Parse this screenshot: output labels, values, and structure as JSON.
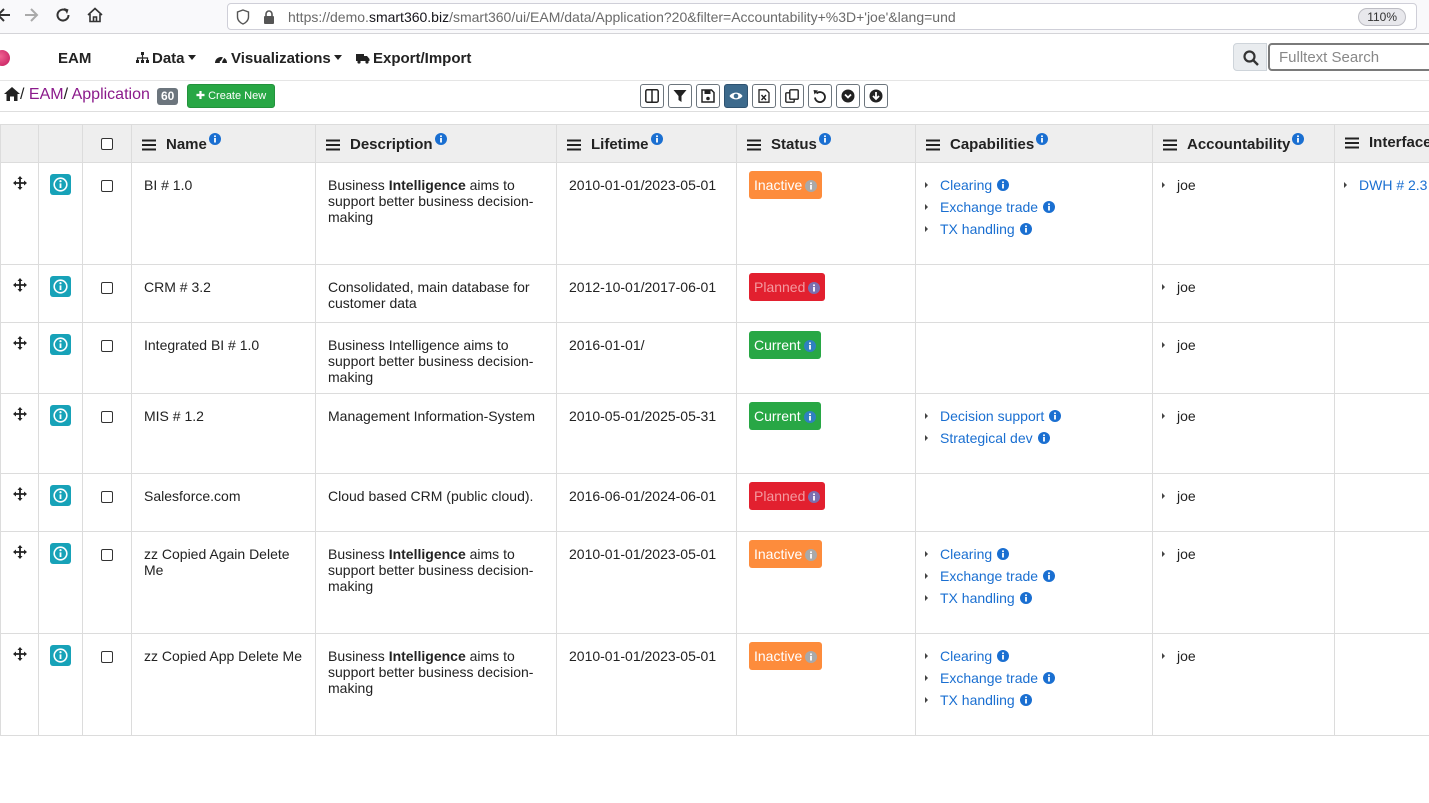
{
  "browser": {
    "url_prefix": "https://demo.",
    "url_host": "smart360.biz",
    "url_path": "/smart360/ui/EAM/data/Application?20&filter=Accountability+%3D+'joe'&lang=und",
    "zoom": "110%"
  },
  "navbar": {
    "brand": "EAM",
    "menu_data": "Data",
    "menu_visualizations": "Visualizations",
    "menu_export": "Export/Import",
    "search_placeholder": "Fulltext Search"
  },
  "breadcrumb": {
    "sep1": "/",
    "eam": "EAM",
    "sep2": "/",
    "application": "Application",
    "count": "60",
    "create_label": "Create New"
  },
  "columns": {
    "name": "Name",
    "description": "Description",
    "lifetime": "Lifetime",
    "status": "Status",
    "capabilities": "Capabilities",
    "accountability": "Accountability",
    "interfaces": "Interfaces"
  },
  "rows": [
    {
      "name": "BI # 1.0",
      "desc_pre": "Business ",
      "desc_bold": "Intelligence",
      "desc_post": " aims to support better business decision-making",
      "lifetime": "2010-01-01/2023-05-01",
      "status": "Inactive",
      "capabilities": [
        "Clearing",
        "Exchange trade",
        "TX handling"
      ],
      "accountability": "joe",
      "interface": "DWH # 2.3"
    },
    {
      "name": "CRM # 3.2",
      "desc_pre": "Consolidated, main database for customer data",
      "desc_bold": "",
      "desc_post": "",
      "lifetime": "2012-10-01/2017-06-01",
      "status": "Planned",
      "capabilities": [],
      "accountability": "joe",
      "interface": ""
    },
    {
      "name": "Integrated BI # 1.0",
      "desc_pre": "Business Intelligence aims to support better business decision-making",
      "desc_bold": "",
      "desc_post": "",
      "lifetime": "2016-01-01/",
      "status": "Current",
      "capabilities": [],
      "accountability": "joe",
      "interface": ""
    },
    {
      "name": "MIS # 1.2",
      "desc_pre": "Management Information-System",
      "desc_bold": "",
      "desc_post": "",
      "lifetime": "2010-05-01/2025-05-31",
      "status": "Current",
      "capabilities": [
        "Decision support",
        "Strategical dev"
      ],
      "accountability": "joe",
      "interface": ""
    },
    {
      "name": "Salesforce.com",
      "desc_pre": "Cloud based CRM (public cloud).",
      "desc_bold": "",
      "desc_post": "",
      "lifetime": "2016-06-01/2024-06-01",
      "status": "Planned",
      "capabilities": [],
      "accountability": "joe",
      "interface": ""
    },
    {
      "name": "zz Copied Again Delete Me",
      "desc_pre": "Business ",
      "desc_bold": "Intelligence",
      "desc_post": " aims to support better business decision-making",
      "lifetime": "2010-01-01/2023-05-01",
      "status": "Inactive",
      "capabilities": [
        "Clearing",
        "Exchange trade",
        "TX handling"
      ],
      "accountability": "joe",
      "interface": ""
    },
    {
      "name": "zz Copied App Delete Me",
      "desc_pre": "Business ",
      "desc_bold": "Intelligence",
      "desc_post": " aims to support better business decision-making",
      "lifetime": "2010-01-01/2023-05-01",
      "status": "Inactive",
      "capabilities": [
        "Clearing",
        "Exchange trade",
        "TX handling"
      ],
      "accountability": "joe",
      "interface": ""
    }
  ],
  "colors": {
    "link": "#1a6fd1",
    "breadcrumb_link": "#8b1a8b",
    "status_inactive": "#fd8c3c",
    "status_planned": "#e2202f",
    "status_current": "#28a745",
    "info_button": "#17a2b8",
    "create_button": "#28a745"
  },
  "icons": {
    "toolbar": [
      "columns-icon",
      "filter-icon",
      "save-icon",
      "eye-icon",
      "excel-export-icon",
      "copy-icon",
      "undo-icon",
      "chevron-down-circle-icon",
      "arrow-down-circle-icon"
    ]
  }
}
